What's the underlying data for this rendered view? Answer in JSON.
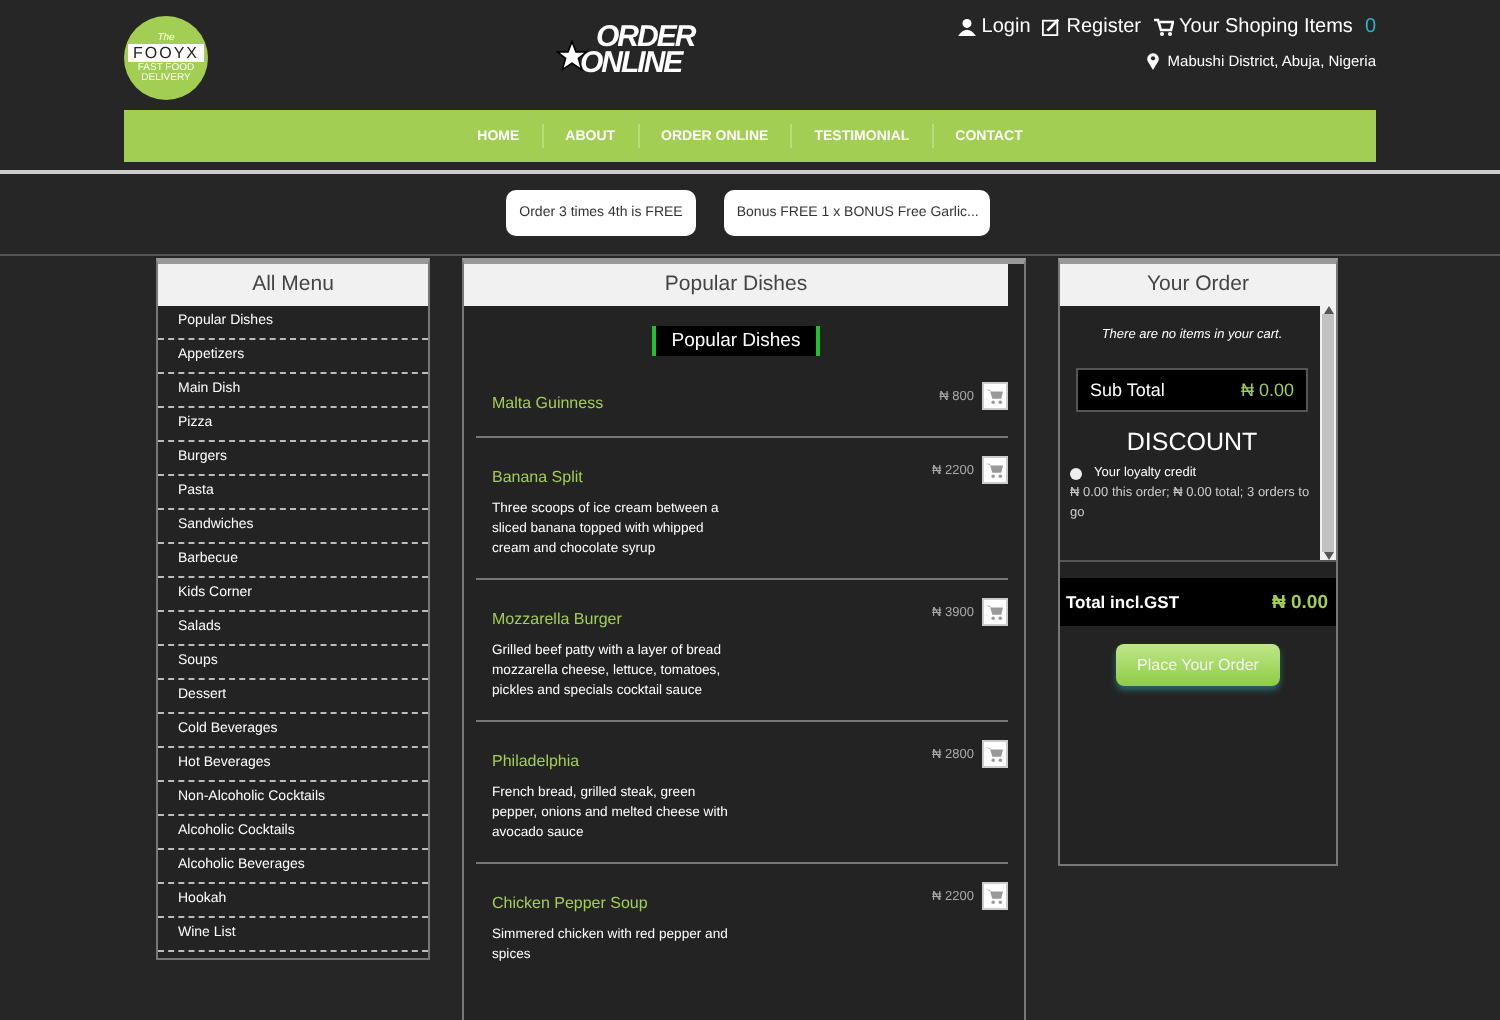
{
  "logo": {
    "tagline_top": "The",
    "name": "FOOYX",
    "subtitle": "FAST FOOD DELIVERY"
  },
  "brand": {
    "line1": "ORDER",
    "line2": "ONLINE"
  },
  "account": {
    "login": "Login",
    "register": "Register",
    "cart_label": "Your Shoping Items",
    "cart_count": "0",
    "location": "Mabushi District, Abuja, Nigeria"
  },
  "nav": [
    "HOME",
    "ABOUT",
    "ORDER ONLINE",
    "TESTIMONIAL",
    "CONTACT"
  ],
  "promos": [
    "Order 3 times 4th is FREE",
    "Bonus FREE 1 x BONUS Free Garlic..."
  ],
  "menu": {
    "title": "All Menu",
    "items": [
      "Popular Dishes",
      "Appetizers",
      "Main Dish",
      "Pizza",
      "Burgers",
      "Pasta",
      "Sandwiches",
      "Barbecue",
      "Kids Corner",
      "Salads",
      "Soups",
      "Dessert",
      "Cold Beverages",
      "Hot Beverages",
      "Non-Alcoholic Cocktails",
      "Alcoholic Cocktails",
      "Alcoholic Beverages",
      "Hookah",
      "Wine List"
    ]
  },
  "dishes": {
    "title": "Popular Dishes",
    "section": "Popular Dishes",
    "items": [
      {
        "name": "Malta Guinness",
        "price": "₦ 800"
      },
      {
        "name": "Banana Split",
        "price": "₦ 2200",
        "description": "Three scoops of ice cream between a sliced banana topped with whipped cream and chocolate syrup"
      },
      {
        "name": "Mozzarella Burger",
        "price": "₦ 3900",
        "description": "Grilled beef patty with a layer of bread mozzarella cheese, lettuce, tomatoes, pickles and specials cocktail sauce"
      },
      {
        "name": "Philadelphia",
        "price": "₦ 2800",
        "description": "French bread, grilled steak, green pepper, onions and melted cheese with avocado sauce"
      },
      {
        "name": "Chicken Pepper Soup",
        "price": "₦ 2200",
        "description": "Simmered chicken with red pepper and spices"
      }
    ]
  },
  "order": {
    "title": "Your Order",
    "empty_note": "There are no items in your cart.",
    "subtotal_label": "Sub Total",
    "subtotal": "₦ 0.00",
    "discount_title": "DISCOUNT",
    "loyalty": {
      "label": "Your loyalty credit",
      "selected": false,
      "note": "₦ 0.00 this order; ₦ 0.00 total; 3 orders to go"
    },
    "total_label": "Total incl.GST",
    "total": "₦ 0.00",
    "button": "Place Your Order"
  }
}
